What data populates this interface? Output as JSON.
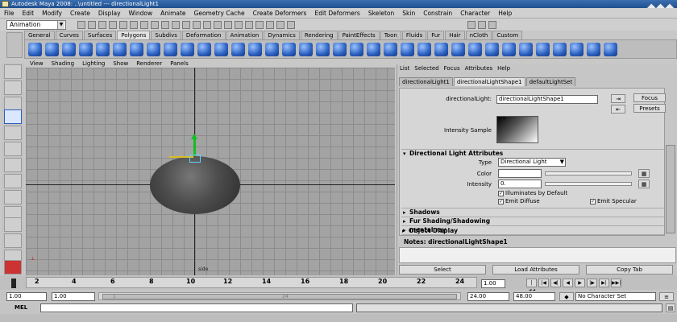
{
  "window": {
    "title": "Autodesk Maya 2008: ..\\untitled   ---   directionalLight1"
  },
  "menubar": [
    "File",
    "Edit",
    "Modify",
    "Create",
    "Display",
    "Window",
    "Animate",
    "Geometry Cache",
    "Create Deformers",
    "Edit Deformers",
    "Skeleton",
    "Skin",
    "Constrain",
    "Character",
    "Help"
  ],
  "statusline": {
    "mode": "Animation"
  },
  "shelf": {
    "tabs": [
      "General",
      "Curves",
      "Surfaces",
      "Polygons",
      "Subdivs",
      "Deformation",
      "Animation",
      "Dynamics",
      "Rendering",
      "PaintEffects",
      "Toon",
      "Fluids",
      "Fur",
      "Hair",
      "nCloth",
      "Custom"
    ],
    "active_tab": "Polygons"
  },
  "viewport": {
    "menu": [
      "View",
      "Shading",
      "Lighting",
      "Show",
      "Renderer",
      "Panels"
    ],
    "camera": "side"
  },
  "attribute_editor": {
    "menu": [
      "List",
      "Selected",
      "Focus",
      "Attributes",
      "Help"
    ],
    "tabs": [
      "directionalLight1",
      "directionalLightShape1",
      "defaultLightSet"
    ],
    "active_tab": "directionalLightShape1",
    "node_label": "directionalLight:",
    "node_value": "directionalLightShape1",
    "focus_label": "Focus",
    "presets_label": "Presets",
    "intensity_sample_label": "Intensity Sample",
    "sections": {
      "directional": "Directional Light Attributes",
      "shadows": "Shadows",
      "fur": "Fur Shading/Shadowing",
      "mental_ray": "mental ray",
      "object_display": "Object Display"
    },
    "type_label": "Type",
    "type_value": "Directional Light",
    "color_label": "Color",
    "intensity_label": "Intensity",
    "intensity_value": "0.",
    "illuminates_label": "Illuminates by Default",
    "emit_diffuse_label": "Emit Diffuse",
    "emit_specular_label": "Emit Specular",
    "notes_label": "Notes:  directionalLightShape1",
    "buttons": {
      "select": "Select",
      "load": "Load Attributes",
      "copy": "Copy Tab"
    }
  },
  "time_slider": {
    "ticks": [
      "2",
      "4",
      "6",
      "8",
      "10",
      "12",
      "14",
      "16",
      "18",
      "20",
      "22",
      "24"
    ],
    "current_frame": "1.00"
  },
  "range_slider": {
    "start": "1.00",
    "playback_start": "1.00",
    "playback_end": "24.00",
    "end": "48.00",
    "character_set": "No Character Set",
    "range_label_start": "1",
    "range_label_end": "24"
  },
  "command_line": {
    "label": "MEL"
  }
}
